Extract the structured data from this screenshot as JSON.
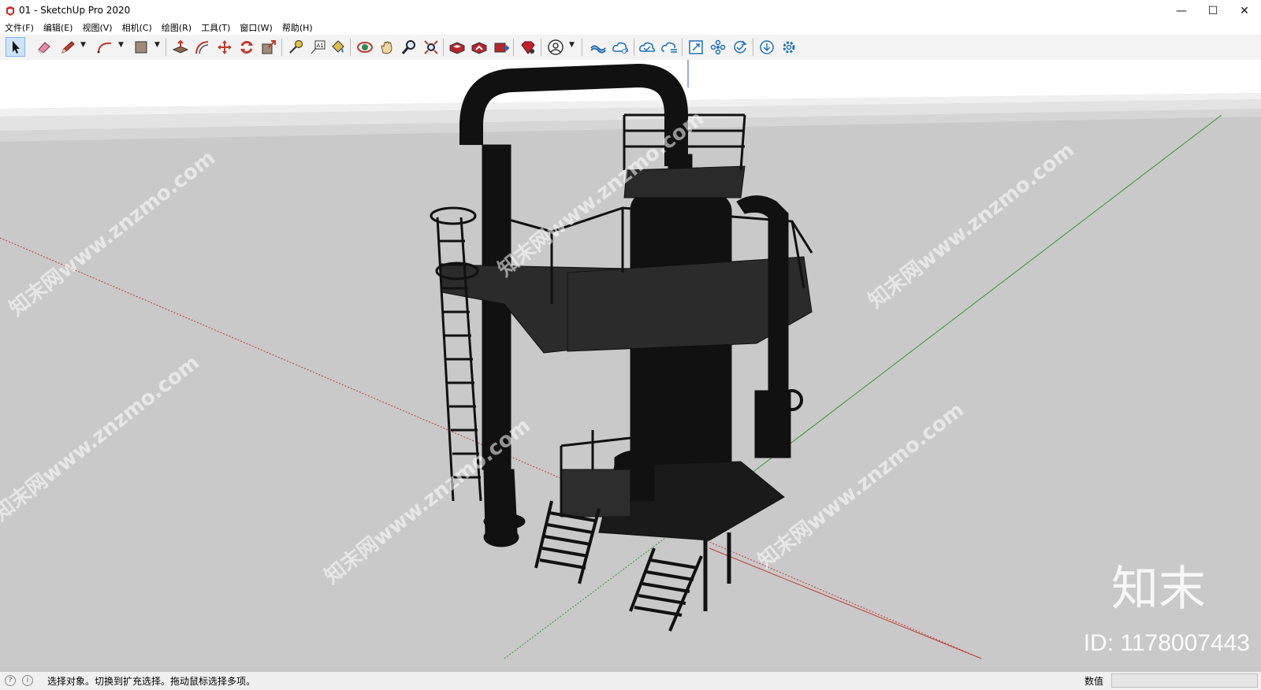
{
  "window": {
    "title": "01 - SketchUp Pro 2020",
    "minimize_glyph": "—",
    "maximize_glyph": "☐",
    "close_glyph": "✕"
  },
  "menu": [
    {
      "label": "文件(F)"
    },
    {
      "label": "编辑(E)"
    },
    {
      "label": "视图(V)"
    },
    {
      "label": "相机(C)"
    },
    {
      "label": "绘图(R)"
    },
    {
      "label": "工具(T)"
    },
    {
      "label": "窗口(W)"
    },
    {
      "label": "帮助(H)"
    }
  ],
  "toolbar": {
    "tools": [
      {
        "name": "select-tool",
        "icon": "arrow-cursor-icon",
        "active": true
      },
      {
        "name": "eraser-tool",
        "icon": "eraser-icon"
      },
      {
        "name": "line-tool",
        "icon": "pencil-icon"
      },
      {
        "name": "arc-tool",
        "icon": "arc-icon"
      },
      {
        "name": "rectangle-tool",
        "icon": "rectangle-icon"
      },
      {
        "name": "push-pull-tool",
        "icon": "push-pull-icon"
      },
      {
        "name": "offset-tool",
        "icon": "offset-icon"
      },
      {
        "name": "move-tool",
        "icon": "move-icon"
      },
      {
        "name": "rotate-tool",
        "icon": "rotate-icon"
      },
      {
        "name": "scale-tool",
        "icon": "scale-icon"
      },
      {
        "name": "tape-measure-tool",
        "icon": "tape-measure-icon"
      },
      {
        "name": "text-tool",
        "icon": "text-icon",
        "glyph": "A1"
      },
      {
        "name": "paint-bucket-tool",
        "icon": "paint-bucket-icon"
      },
      {
        "name": "orbit-tool",
        "icon": "orbit-icon"
      },
      {
        "name": "pan-tool",
        "icon": "hand-icon"
      },
      {
        "name": "zoom-tool",
        "icon": "magnifier-icon"
      },
      {
        "name": "zoom-extents-tool",
        "icon": "zoom-extents-icon"
      },
      {
        "name": "warehouse-tool",
        "icon": "warehouse-icon"
      },
      {
        "name": "share-model-tool",
        "icon": "share-model-icon"
      },
      {
        "name": "extension-warehouse-tool",
        "icon": "extension-warehouse-icon"
      },
      {
        "name": "ruby-tool",
        "icon": "ruby-gem-icon"
      },
      {
        "name": "account-tool",
        "icon": "user-circle-icon"
      },
      {
        "name": "cloud-sync-tool",
        "icon": "cloud-link-icon"
      },
      {
        "name": "cloud-share-tool",
        "icon": "cloud-share-icon"
      },
      {
        "name": "cloud-check-tool",
        "icon": "cloud-check-icon"
      },
      {
        "name": "cloud-list-tool",
        "icon": "cloud-list-icon"
      },
      {
        "name": "frame-tool",
        "icon": "frame-expand-icon"
      },
      {
        "name": "component-tool",
        "icon": "component-dots-icon"
      },
      {
        "name": "refresh-check-tool",
        "icon": "refresh-check-icon"
      },
      {
        "name": "download-tool",
        "icon": "download-circle-icon"
      },
      {
        "name": "settings-tool",
        "icon": "gear-icon"
      }
    ]
  },
  "viewport": {
    "watermarks": [
      "知末网www.znzmo.com"
    ],
    "logo_text": "知末",
    "id_text": "ID: 1178007443",
    "colors": {
      "ground": "#c9c9c9",
      "sky": "#ffffff",
      "model": "#111111",
      "axis_red": "#c0392b",
      "axis_green": "#2e9a2e"
    }
  },
  "status": {
    "text": "选择对象。切换到扩充选择。拖动鼠标选择多项。",
    "measure_label": "数值",
    "measure_value": ""
  }
}
